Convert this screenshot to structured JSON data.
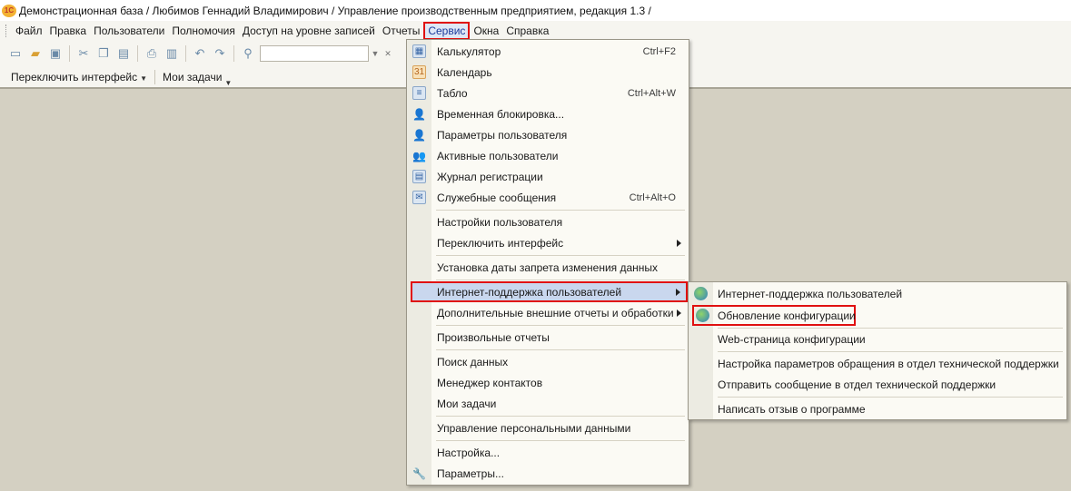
{
  "window": {
    "logo_text": "1С",
    "title": "Демонстрационная база / Любимов Геннадий Владимирович /  Управление производственным предприятием, редакция 1.3 /"
  },
  "menubar": {
    "items": [
      {
        "label": "Файл"
      },
      {
        "label": "Правка"
      },
      {
        "label": "Пользователи"
      },
      {
        "label": "Полномочия"
      },
      {
        "label": "Доступ на уровне записей"
      },
      {
        "label": "Отчеты"
      },
      {
        "label": "Сервис",
        "active": true
      },
      {
        "label": "Окна"
      },
      {
        "label": "Справка"
      }
    ]
  },
  "toolbar": {
    "icons": [
      "new-document-icon",
      "open-folder-icon",
      "save-icon",
      "cut-icon",
      "copy-icon",
      "paste-icon",
      "print-icon",
      "print-preview-icon",
      "undo-icon",
      "redo-icon",
      "search-icon"
    ],
    "search_placeholder": ""
  },
  "panel": {
    "switch_interface": "Переключить интерфейс",
    "my_tasks": "Мои задачи"
  },
  "service_menu": {
    "items": [
      {
        "label": "Калькулятор",
        "shortcut": "Ctrl+F2",
        "icon": "calculator-icon"
      },
      {
        "label": "Календарь",
        "shortcut": "",
        "icon": "calendar-icon"
      },
      {
        "label": "Табло",
        "shortcut": "Ctrl+Alt+W",
        "icon": "scoreboard-icon"
      },
      {
        "label": "Временная блокировка...",
        "shortcut": "",
        "icon": "user-lock-icon"
      },
      {
        "label": "Параметры пользователя",
        "shortcut": "",
        "icon": "user-settings-icon"
      },
      {
        "label": "Активные пользователи",
        "shortcut": "",
        "icon": "active-users-icon"
      },
      {
        "label": "Журнал регистрации",
        "shortcut": "",
        "icon": "log-icon"
      },
      {
        "label": "Служебные сообщения",
        "shortcut": "Ctrl+Alt+O",
        "icon": "messages-icon"
      },
      {
        "label": "Настройки пользователя",
        "shortcut": ""
      },
      {
        "label": "Переключить интерфейс",
        "shortcut": "",
        "submenu": true
      },
      {
        "label": "Установка даты запрета изменения данных",
        "shortcut": ""
      },
      {
        "label": "Интернет-поддержка пользователей",
        "shortcut": "",
        "submenu": true,
        "highlighted": true
      },
      {
        "label": "Дополнительные внешние отчеты и обработки",
        "shortcut": "",
        "submenu": true
      },
      {
        "label": "Произвольные отчеты",
        "shortcut": ""
      },
      {
        "label": "Поиск данных",
        "shortcut": ""
      },
      {
        "label": "Менеджер контактов",
        "shortcut": ""
      },
      {
        "label": "Мои задачи",
        "shortcut": ""
      },
      {
        "label": "Управление персональными данными",
        "shortcut": ""
      },
      {
        "label": "Настройка...",
        "shortcut": ""
      },
      {
        "label": "Параметры...",
        "shortcut": "",
        "icon": "wrench-icon"
      }
    ]
  },
  "support_submenu": {
    "items": [
      {
        "label": "Интернет-поддержка пользователей",
        "icon": "globe-icon"
      },
      {
        "label": "Обновление конфигурации",
        "icon": "update-globe-icon",
        "outlined": true
      },
      {
        "label": "Web-страница конфигурации"
      },
      {
        "label": "Настройка параметров обращения в отдел технической поддержки"
      },
      {
        "label": "Отправить сообщение в отдел технической поддержки"
      },
      {
        "label": "Написать отзыв о программе"
      }
    ]
  },
  "colors": {
    "highlight_outline": "#e01010",
    "menu_bg": "#fbfaf4",
    "workspace_bg": "#d4d0c2",
    "selected_bg": "#c9d7ee"
  }
}
